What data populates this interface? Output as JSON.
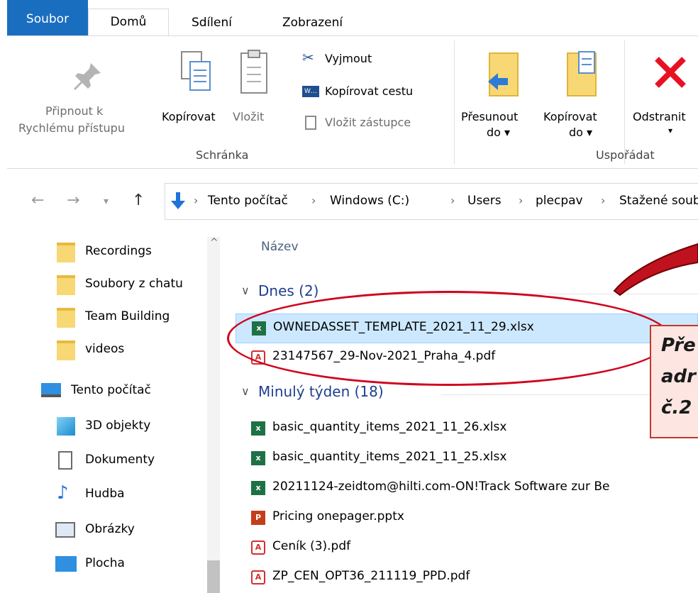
{
  "ribbon": {
    "tabs": [
      "Soubor",
      "Domů",
      "Sdílení",
      "Zobrazení"
    ],
    "clipboard": {
      "pin_line1": "Připnout k",
      "pin_line2": "Rychlému přístupu",
      "copy": "Kopírovat",
      "paste": "Vložit",
      "cut": "Vyjmout",
      "copy_path": "Kopírovat cestu",
      "paste_shortcut": "Vložit zástupce",
      "group_title": "Schránka"
    },
    "organize": {
      "move_line1": "Přesunout",
      "move_line2": "do ▾",
      "copy_line1": "Kopírovat",
      "copy_line2": "do ▾",
      "delete_label": "Odstranit",
      "delete_arrow": "▾",
      "group_title": "Uspořádat"
    }
  },
  "address": {
    "crumbs": [
      "Tento počítač",
      "Windows (C:)",
      "Users",
      "plecpav",
      "Stažené soubory"
    ]
  },
  "nav_pane": {
    "items": [
      {
        "label": "Recordings",
        "icon": "folder-icon"
      },
      {
        "label": "Soubory z chatu",
        "icon": "folder-icon"
      },
      {
        "label": "Team Building",
        "icon": "folder-icon"
      },
      {
        "label": "videos",
        "icon": "folder-icon"
      },
      {
        "label": "Tento počítač",
        "icon": "computer-icon"
      },
      {
        "label": "3D objekty",
        "icon": "3d-objects-icon"
      },
      {
        "label": "Dokumenty",
        "icon": "documents-icon"
      },
      {
        "label": "Hudba",
        "icon": "music-icon"
      },
      {
        "label": "Obrázky",
        "icon": "pictures-icon"
      },
      {
        "label": "Plocha",
        "icon": "desktop-icon"
      }
    ]
  },
  "file_list": {
    "column_name": "Název",
    "groups": [
      {
        "title": "Dnes (2)",
        "files": [
          {
            "name": "OWNEDASSET_TEMPLATE_2021_11_29.xlsx",
            "type": "xlsx",
            "selected": true
          },
          {
            "name": "23147567_29-Nov-2021_Praha_4.pdf",
            "type": "pdf",
            "selected": false
          }
        ]
      },
      {
        "title": "Minulý týden (18)",
        "files": [
          {
            "name": "basic_quantity_items_2021_11_26.xlsx",
            "type": "xlsx"
          },
          {
            "name": "basic_quantity_items_2021_11_25.xlsx",
            "type": "xlsx"
          },
          {
            "name": "20211124-zeidtom@hilti.com-ON!Track Software zur Be",
            "type": "xlsx"
          },
          {
            "name": "Pricing onepager.pptx",
            "type": "pptx"
          },
          {
            "name": "Ceník (3).pdf",
            "type": "pdf"
          },
          {
            "name": "ZP_CEN_OPT36_211119_PPD.pdf",
            "type": "pdf"
          }
        ]
      }
    ]
  },
  "callout": {
    "line1": "Pře",
    "line2": "adr",
    "line3": "č.2"
  },
  "colors": {
    "soubor_tab": "#1a6ec0",
    "selection": "#cce8ff",
    "group_header": "#1e3f8f",
    "annotation_red": "#d0021b"
  }
}
